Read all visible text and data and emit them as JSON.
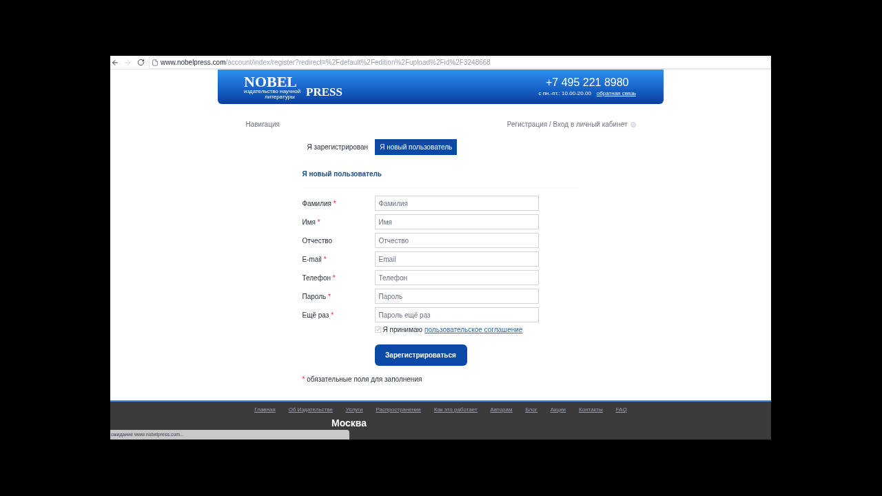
{
  "browser": {
    "url_host": "www.nobelpress.com",
    "url_path": "/account/index/register?redirect=%2Fdefault%2Fedition%2Fupload%2Fid%2F3248668",
    "status": "ожидание www.nobelpress.com..."
  },
  "header": {
    "logo_top": "NOBEL",
    "logo_sub_1": "издательство научной",
    "logo_sub_2": "литературы",
    "logo_bottom": "PRESS",
    "phone": "+7 495 221 8980",
    "hours": "с пн.-пт.: 10.00-20.00",
    "feedback": "обратная связь"
  },
  "nav": {
    "left": "Навигация",
    "right": "Регистрация / Вход в личный кабинет"
  },
  "tabs": [
    {
      "label": "Я зарегистрирован",
      "selected": false
    },
    {
      "label": "Я новый пользователь",
      "selected": true
    }
  ],
  "form": {
    "title": "Я новый пользователь",
    "fields": [
      {
        "label": "Фамилия",
        "required": true,
        "placeholder": "Фамилия"
      },
      {
        "label": "Имя",
        "required": true,
        "placeholder": "Имя"
      },
      {
        "label": "Отчество",
        "required": false,
        "placeholder": "Отчество"
      },
      {
        "label": "E-mail",
        "required": true,
        "placeholder": "Email"
      },
      {
        "label": "Телефон",
        "required": true,
        "placeholder": "Телефон"
      },
      {
        "label": "Пароль",
        "required": true,
        "placeholder": "Пароль"
      },
      {
        "label": "Ещё раз",
        "required": true,
        "placeholder": "Пароль ещё раз"
      }
    ],
    "required_mark": "*",
    "agree": {
      "text": "Я принимаю",
      "link": "пользовательское соглашение",
      "checked": true
    },
    "submit": "Зарегистрироваться",
    "note": "обязательные поля для заполнения"
  },
  "footer": {
    "links": [
      "Главная",
      "Об Издательстве",
      "Услуги",
      "Распространение",
      "Как это работает",
      "Авторам",
      "Блог",
      "Акции",
      "Контакты",
      "FAQ"
    ],
    "city": "Москва"
  }
}
